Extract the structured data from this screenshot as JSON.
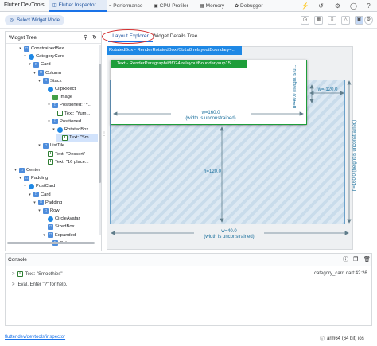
{
  "app_title": "Flutter DevTools",
  "tabs": [
    {
      "label": "Flutter Inspector",
      "icon": "inspector-icon"
    },
    {
      "label": "Performance",
      "icon": "performance-icon"
    },
    {
      "label": "CPU Profiler",
      "icon": "cpu-icon"
    },
    {
      "label": "Memory",
      "icon": "memory-icon"
    },
    {
      "label": "Debugger",
      "icon": "debugger-icon"
    }
  ],
  "toolbar": {
    "select_widget_mode": "Select Widget Mode"
  },
  "widget_tree": {
    "title": "Widget Tree",
    "rows": [
      {
        "label": "ConstrainedBox",
        "icon": "layout"
      },
      {
        "label": "CategoryCard",
        "icon": "circle"
      },
      {
        "label": "Card",
        "icon": "layout"
      },
      {
        "label": "Column",
        "icon": "layout"
      },
      {
        "label": "Stack",
        "icon": "layout"
      },
      {
        "label": "ClipRRect",
        "icon": "circle"
      },
      {
        "label": "Image",
        "icon": "img"
      },
      {
        "label": "Positioned: \"Y...",
        "icon": "layout"
      },
      {
        "label": "Text: \"Yum...",
        "icon": "text"
      },
      {
        "label": "Positioned",
        "icon": "layout"
      },
      {
        "label": "RotatedBox",
        "icon": "circle"
      },
      {
        "label": "Text: \"Sm...",
        "icon": "text"
      },
      {
        "label": "ListTile",
        "icon": "layout"
      },
      {
        "label": "Text: \"Dessert\"",
        "icon": "text"
      },
      {
        "label": "Text: \"16 place...",
        "icon": "text"
      },
      {
        "label": "Center",
        "icon": "layout"
      },
      {
        "label": "Padding",
        "icon": "layout"
      },
      {
        "label": "PostCard",
        "icon": "circle"
      },
      {
        "label": "Card",
        "icon": "layout"
      },
      {
        "label": "Padding",
        "icon": "layout"
      },
      {
        "label": "Row",
        "icon": "layout"
      },
      {
        "label": "CircleAvatar",
        "icon": "circle"
      },
      {
        "label": "SizedBox",
        "icon": "layout"
      },
      {
        "label": "Expanded",
        "icon": "layout"
      },
      {
        "label": "Column",
        "icon": "layout"
      }
    ]
  },
  "detail_tabs": {
    "layout_explorer": "Layout Explorer",
    "details_tree": "Widget Details Tree"
  },
  "layout_explorer": {
    "outer_label": "RotatedBox - RenderRotatedBox#5b1a8 relayoutBoundary=...",
    "inner_label": "Text - RenderParagraph#8f024 relayoutBoundary=up15",
    "inner_width_line1": "w=160.0",
    "inner_width_line2": "(width is unconstrained)",
    "inner_height_line1": "h=40.0",
    "inner_height_line2": "(height is u...",
    "side_width": "w=-120.0",
    "outer_height_line1": "h=160.0",
    "outer_height_line2": "(height is unconstrained)",
    "middle_height": "h=120.0",
    "outer_width_line1": "w=40.0",
    "outer_width_line2": "(width is unconstrained)"
  },
  "console": {
    "title": "Console",
    "lines": [
      {
        "prefix": ">",
        "text": "Text: \"Smoothies\"",
        "source": "category_card.dart:42:26"
      },
      {
        "prefix": ">",
        "text": "Eval. Enter \"?\" for help.",
        "source": ""
      }
    ]
  },
  "footer": {
    "link": "flutter.dev/devtools/inspector",
    "device": "arm64 (64 bit) ios"
  }
}
